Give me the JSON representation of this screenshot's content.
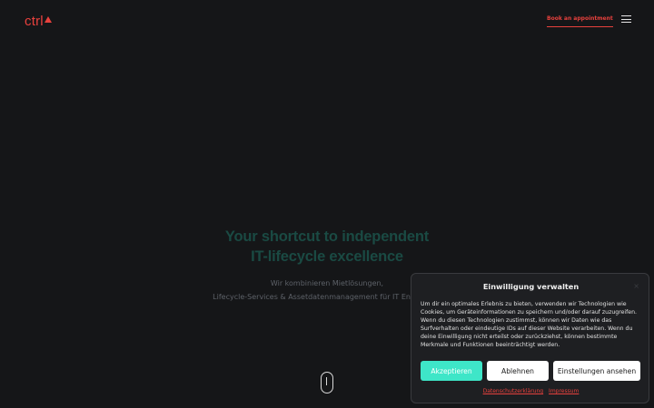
{
  "header": {
    "logo_text": "ctrl",
    "book_label": "Book an appointment"
  },
  "hero": {
    "title_line1": "Your shortcut to independent",
    "title_line2": "IT-lifecycle excellence",
    "sub_line1": "Wir kombinieren Mietlösungen,",
    "sub_line2": "Lifecycle-Services & Assetdatenmanagement für IT Endgeräte."
  },
  "consent": {
    "title": "Einwilligung verwalten",
    "close": "×",
    "text": "Um dir ein optimales Erlebnis zu bieten, verwenden wir Technologien wie Cookies, um Geräteinformationen zu speichern und/oder darauf zuzugreifen. Wenn du diesen Technologien zustimmst, können wir Daten wie das Surfverhalten oder eindeutige IDs auf dieser Website verarbeiten. Wenn du deine Einwilligung nicht erteilst oder zurückziehst, können bestimmte Merkmale und Funktionen beeinträchtigt werden.",
    "accept_label": "Akzeptieren",
    "decline_label": "Ablehnen",
    "settings_label": "Einstellungen ansehen",
    "privacy_link": "Datenschutzerklärung",
    "imprint_link": "Impressum"
  },
  "colors": {
    "background": "#151618",
    "brand_red": "#e8413d",
    "accent_teal": "#3ee6c8",
    "hero_title": "#1a4a43"
  }
}
